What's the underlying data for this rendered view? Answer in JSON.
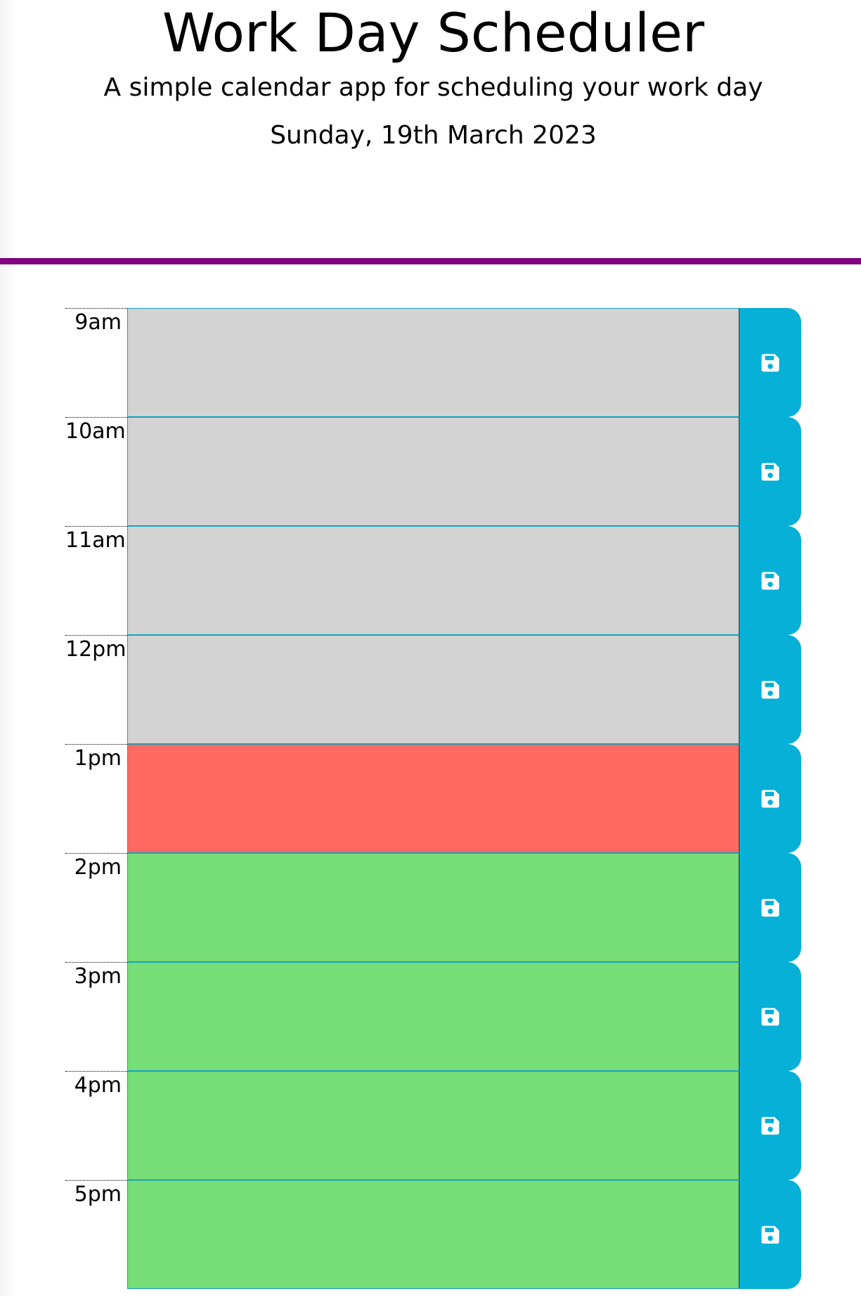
{
  "header": {
    "title": "Work Day Scheduler",
    "lead": "A simple calendar app for scheduling your work day",
    "date": "Sunday, 19th March 2023"
  },
  "colors": {
    "divider": "#800080",
    "past": "#d3d3d3",
    "present": "#ff6961",
    "future": "#77dd77",
    "save_button": "#06b0d6"
  },
  "schedule": {
    "rows": [
      {
        "hour": "9am",
        "status": "past",
        "text": ""
      },
      {
        "hour": "10am",
        "status": "past",
        "text": ""
      },
      {
        "hour": "11am",
        "status": "past",
        "text": ""
      },
      {
        "hour": "12pm",
        "status": "past",
        "text": ""
      },
      {
        "hour": "1pm",
        "status": "present",
        "text": ""
      },
      {
        "hour": "2pm",
        "status": "future",
        "text": ""
      },
      {
        "hour": "3pm",
        "status": "future",
        "text": ""
      },
      {
        "hour": "4pm",
        "status": "future",
        "text": ""
      },
      {
        "hour": "5pm",
        "status": "future",
        "text": ""
      }
    ],
    "save_icon": "floppy-disk-icon"
  }
}
